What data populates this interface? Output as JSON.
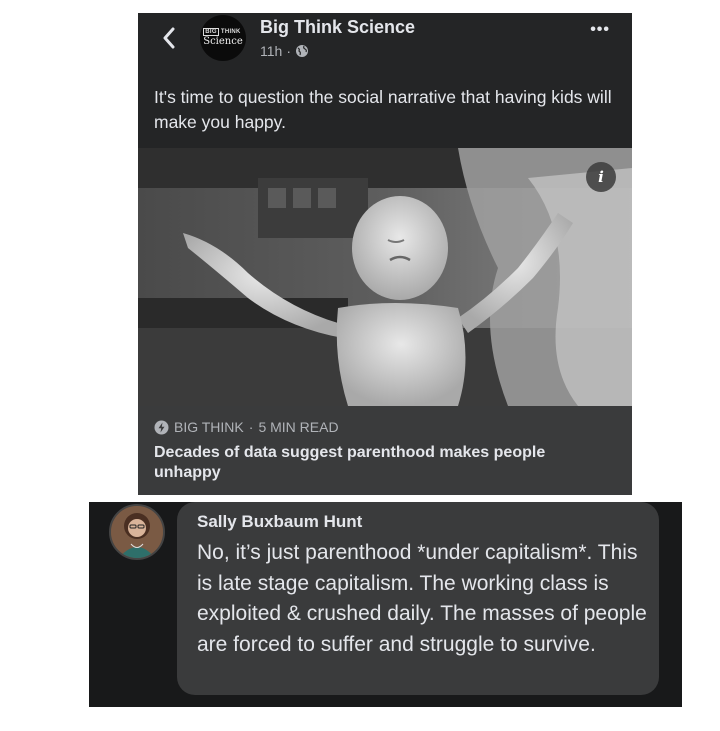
{
  "post": {
    "page_name": "Big Think Science",
    "time": "11h",
    "separator": "·",
    "logo_text_top": "BIG THINK",
    "logo_text_top_a": "BIG",
    "logo_text_top_b": "THINK",
    "logo_text_bottom": "Science",
    "more_label": "•••",
    "caption": "It's time to question the social narrative that having kids will make you happy.",
    "info_label": "i",
    "link": {
      "source": "BIG THINK",
      "separator": "·",
      "read_time": "5 MIN READ",
      "headline": "Decades of data suggest parenthood makes people unhappy"
    }
  },
  "comment": {
    "author": "Sally Buxbaum Hunt",
    "text": "No, it’s just parenthood *under capitalism*. This is late stage capitalism. The working class is exploited & crushed daily. The masses of people are forced to suffer and struggle to survive."
  },
  "icons": [
    "back-arrow-icon",
    "globe-icon",
    "more-options-icon",
    "info-icon",
    "lightning-bolt-icon"
  ],
  "colors": {
    "card_bg": "#242526",
    "link_box_bg": "#3a3b3c",
    "comment_bg": "#18191a",
    "bubble_bg": "#3a3b3c",
    "primary_text": "#e4e6eb",
    "secondary_text": "#b0b3b8"
  }
}
